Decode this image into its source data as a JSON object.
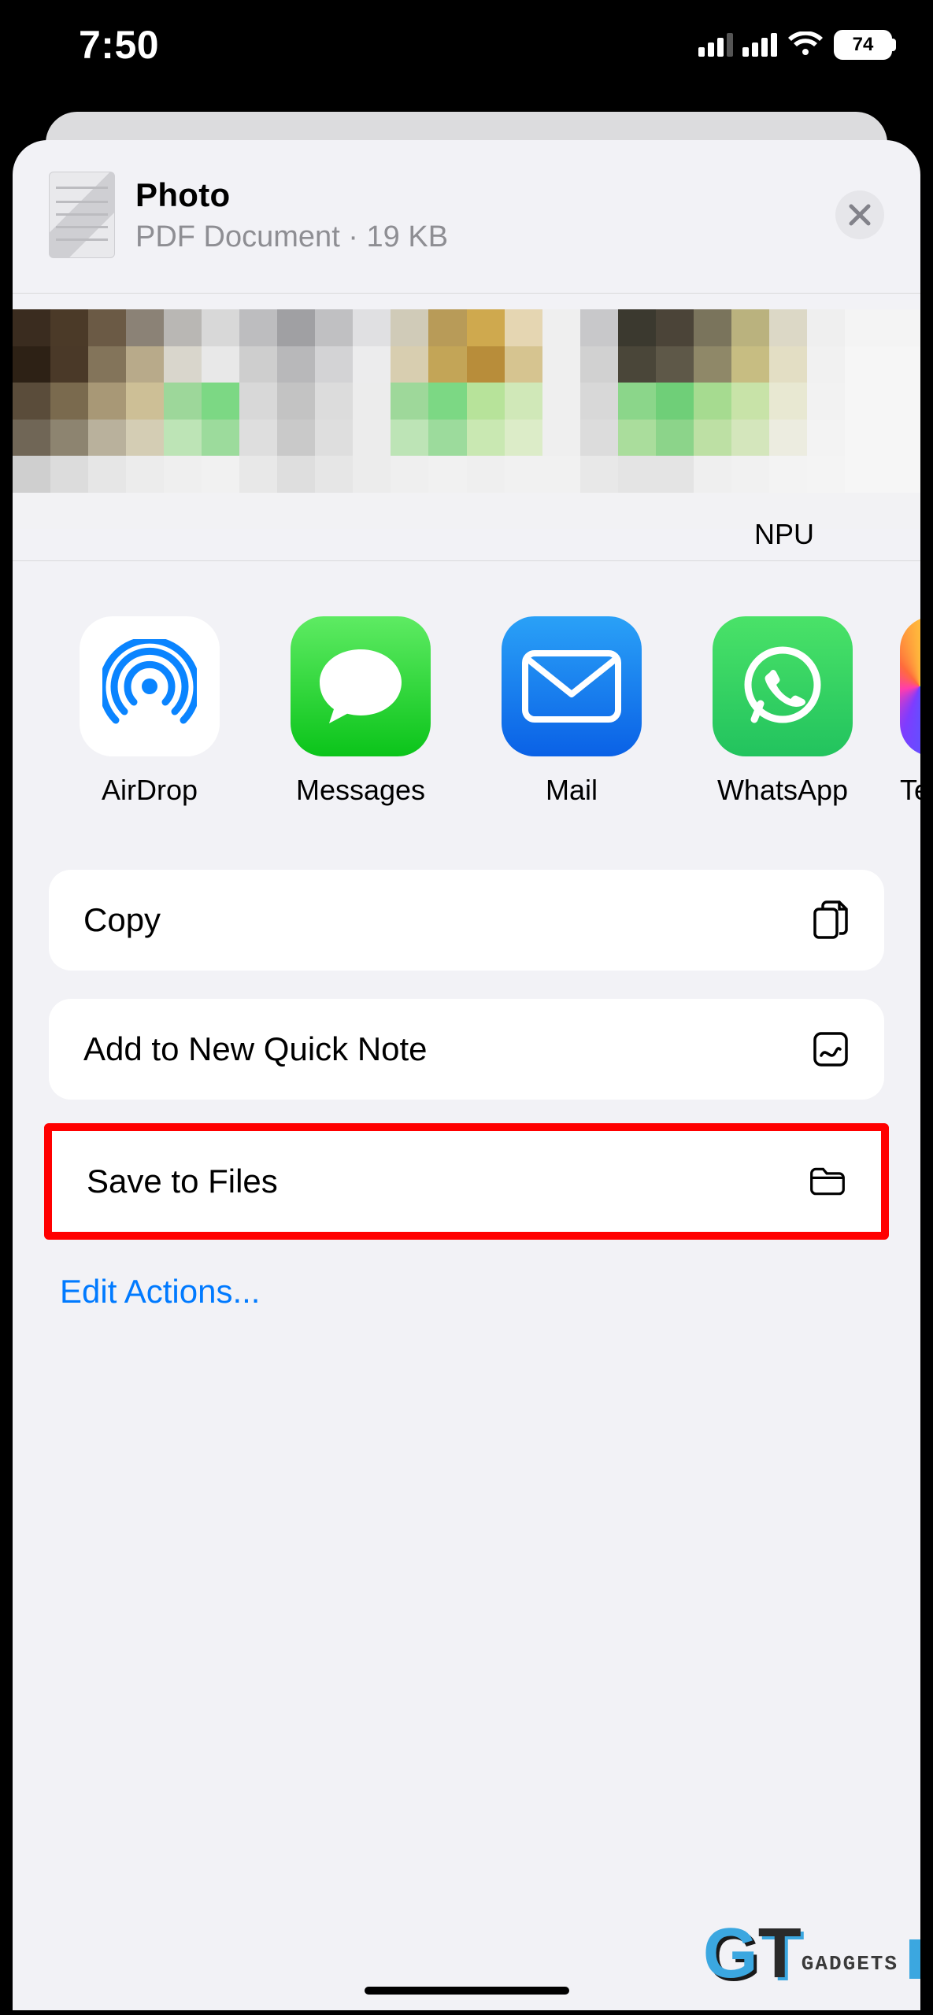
{
  "status": {
    "time": "7:50",
    "battery": "74"
  },
  "share": {
    "title": "Photo",
    "subtitle": "PDF Document · 19 KB"
  },
  "contacts": [
    {
      "label": ""
    },
    {
      "label": ""
    },
    {
      "label": ""
    },
    {
      "label": "NPU"
    }
  ],
  "apps": [
    {
      "label": "AirDrop"
    },
    {
      "label": "Messages"
    },
    {
      "label": "Mail"
    },
    {
      "label": "WhatsApp"
    },
    {
      "label": "Te"
    }
  ],
  "actions": {
    "copy": "Copy",
    "quicknote": "Add to New Quick Note",
    "savefiles": "Save to Files",
    "edit": "Edit Actions..."
  },
  "watermark": {
    "brand_g": "G",
    "brand_t": "T",
    "brand_text": "GADGETS"
  }
}
